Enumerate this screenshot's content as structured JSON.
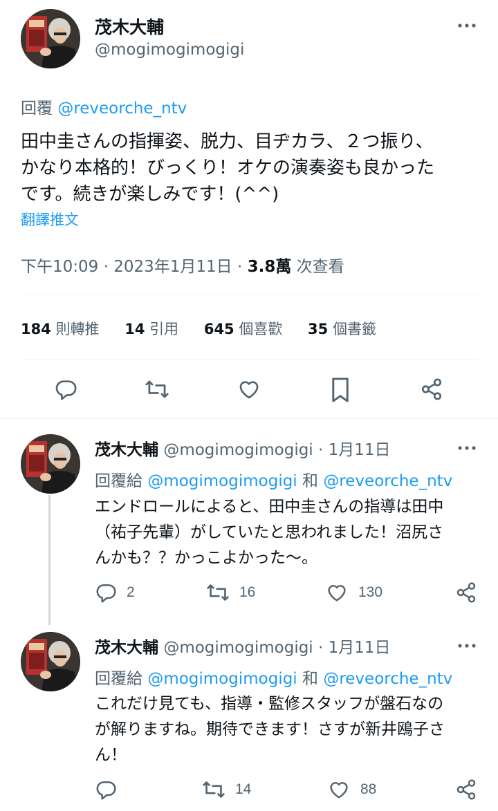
{
  "main_tweet": {
    "author_name": "茂木大輔",
    "author_handle": "@mogimogimogigi",
    "reply_prefix": "回覆",
    "reply_to": "@reveorche_ntv",
    "text_lines": [
      "田中圭さんの指揮姿、脱力、目ヂカラ、２つ振り、",
      "かなり本格的！びっくり！オケの演奏姿も良かった",
      "です。続きが楽しみです！(^^)"
    ],
    "translate": "翻譯推文",
    "time": "下午10:09",
    "date": "2023年1月11日",
    "views_count": "3.8萬",
    "views_label": "次查看",
    "stats": {
      "retweets_count": "184",
      "retweets_label": "則轉推",
      "quotes_count": "14",
      "quotes_label": "引用",
      "likes_count": "645",
      "likes_label": "個喜歡",
      "bookmarks_count": "35",
      "bookmarks_label": "個書籤"
    }
  },
  "replies": [
    {
      "author_name": "茂木大輔",
      "author_handle": "@mogimogimogigi",
      "date": "1月11日",
      "reply_prefix": "回覆給",
      "reply_to_1": "@mogimogimogigi",
      "reply_and": "和",
      "reply_to_2": "@reveorche_ntv",
      "text_lines": [
        "エンドロールによると、田中圭さんの指導は田中",
        "（祐子先輩）がしていたと思われました！沼尻さ",
        "んかも？？かっこよかった〜。"
      ],
      "replies_count": "2",
      "retweets_count": "16",
      "likes_count": "130"
    },
    {
      "author_name": "茂木大輔",
      "author_handle": "@mogimogimogigi",
      "date": "1月11日",
      "reply_prefix": "回覆給",
      "reply_to_1": "@mogimogimogigi",
      "reply_and": "和",
      "reply_to_2": "@reveorche_ntv",
      "text_lines": [
        "これだけ見ても、指導・監修スタッフが盤石なの",
        "が解りますね。期待できます！さすが新井鴎子さ",
        "ん！"
      ],
      "retweets_count": "14",
      "likes_count": "88"
    }
  ],
  "separator_dot": "·",
  "colors": {
    "accent": "#1d9bf0",
    "secondary_text": "#536471",
    "primary_text": "#0f1419",
    "divider": "#eff3f4"
  }
}
